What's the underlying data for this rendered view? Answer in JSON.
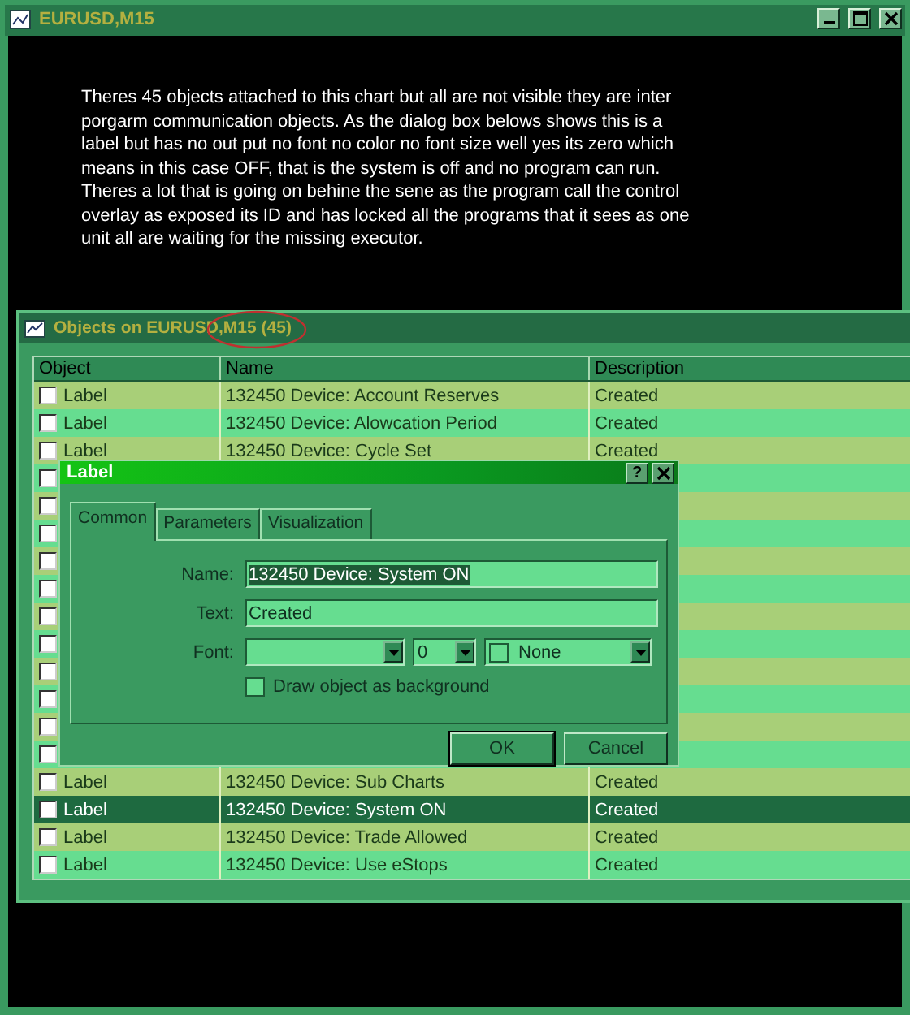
{
  "window": {
    "title": "EURUSD,M15"
  },
  "chart": {
    "note": "Theres 45 objects attached to this chart but all are not visible they are inter porgarm communication objects. As the dialog box belows shows this is a label but has no out put no font no color no font size well yes its zero which means in this case OFF, that is the system is off and no program can run. Theres a lot that is going on behine the sene as the program call the control overlay as exposed its ID and has locked all the programs that it sees as one unit all are waiting for the missing executor."
  },
  "objects_window": {
    "title": "Objects on EURUSD,M15 (45)",
    "columns": [
      "Object",
      "Name",
      "Description"
    ],
    "rows": [
      {
        "object": "Label",
        "name": "132450 Device: Account Reserves",
        "description": "Created",
        "checked": false,
        "selected": false
      },
      {
        "object": "Label",
        "name": "132450 Device: Alowcation Period",
        "description": "Created",
        "checked": false,
        "selected": false
      },
      {
        "object": "Label",
        "name": "132450 Device: Cycle Set",
        "description": "Created",
        "checked": false,
        "selected": false
      },
      {
        "checked": false,
        "selected": false
      },
      {
        "checked": false,
        "selected": false
      },
      {
        "checked": false,
        "selected": false
      },
      {
        "checked": false,
        "selected": false
      },
      {
        "checked": false,
        "selected": false
      },
      {
        "checked": false,
        "selected": false
      },
      {
        "checked": false,
        "selected": false
      },
      {
        "checked": false,
        "selected": false
      },
      {
        "checked": false,
        "selected": false
      },
      {
        "checked": false,
        "selected": false
      },
      {
        "checked": false,
        "selected": false
      },
      {
        "object": "Label",
        "name": "132450 Device: Sub Charts",
        "description": "Created",
        "checked": false,
        "selected": false
      },
      {
        "object": "Label",
        "name": "132450 Device: System ON",
        "description": "Created",
        "checked": false,
        "selected": true
      },
      {
        "object": "Label",
        "name": "132450 Device: Trade Allowed",
        "description": "Created",
        "checked": false,
        "selected": false
      },
      {
        "object": "Label",
        "name": "132450 Device: Use eStops",
        "description": "Created",
        "checked": false,
        "selected": false
      }
    ]
  },
  "dialog": {
    "title": "Label",
    "help": "?",
    "tabs": [
      {
        "label": "Common",
        "selected": true
      },
      {
        "label": "Parameters",
        "selected": false
      },
      {
        "label": "Visualization",
        "selected": false
      }
    ],
    "name_label": "Name:",
    "name_value": "132450 Device: System ON",
    "name_highlighted": true,
    "text_label": "Text:",
    "text_value": "Created",
    "font_label": "Font:",
    "font_size": "0",
    "color_value": "None",
    "background_label": "Draw object as background",
    "background_checked": false,
    "buttons": [
      "OK",
      "Cancel"
    ]
  }
}
